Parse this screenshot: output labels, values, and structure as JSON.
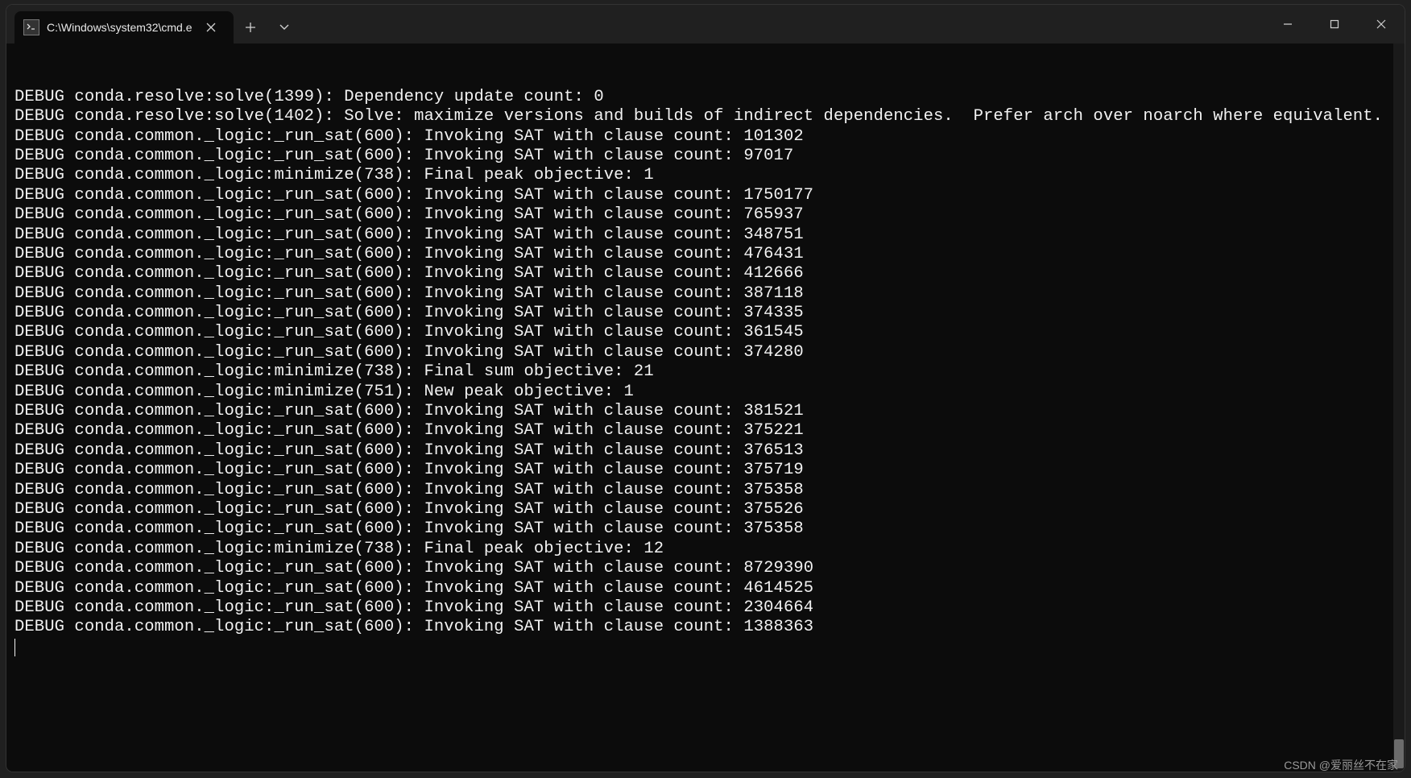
{
  "tab": {
    "title": "C:\\Windows\\system32\\cmd.e"
  },
  "lines": [
    "DEBUG conda.resolve:solve(1399): Dependency update count: 0",
    "DEBUG conda.resolve:solve(1402): Solve: maximize versions and builds of indirect dependencies.  Prefer arch over noarch where equivalent.",
    "DEBUG conda.common._logic:_run_sat(600): Invoking SAT with clause count: 101302",
    "DEBUG conda.common._logic:_run_sat(600): Invoking SAT with clause count: 97017",
    "DEBUG conda.common._logic:minimize(738): Final peak objective: 1",
    "DEBUG conda.common._logic:_run_sat(600): Invoking SAT with clause count: 1750177",
    "DEBUG conda.common._logic:_run_sat(600): Invoking SAT with clause count: 765937",
    "DEBUG conda.common._logic:_run_sat(600): Invoking SAT with clause count: 348751",
    "DEBUG conda.common._logic:_run_sat(600): Invoking SAT with clause count: 476431",
    "DEBUG conda.common._logic:_run_sat(600): Invoking SAT with clause count: 412666",
    "DEBUG conda.common._logic:_run_sat(600): Invoking SAT with clause count: 387118",
    "DEBUG conda.common._logic:_run_sat(600): Invoking SAT with clause count: 374335",
    "DEBUG conda.common._logic:_run_sat(600): Invoking SAT with clause count: 361545",
    "DEBUG conda.common._logic:_run_sat(600): Invoking SAT with clause count: 374280",
    "DEBUG conda.common._logic:minimize(738): Final sum objective: 21",
    "DEBUG conda.common._logic:minimize(751): New peak objective: 1",
    "DEBUG conda.common._logic:_run_sat(600): Invoking SAT with clause count: 381521",
    "DEBUG conda.common._logic:_run_sat(600): Invoking SAT with clause count: 375221",
    "DEBUG conda.common._logic:_run_sat(600): Invoking SAT with clause count: 376513",
    "DEBUG conda.common._logic:_run_sat(600): Invoking SAT with clause count: 375719",
    "DEBUG conda.common._logic:_run_sat(600): Invoking SAT with clause count: 375358",
    "DEBUG conda.common._logic:_run_sat(600): Invoking SAT with clause count: 375526",
    "DEBUG conda.common._logic:_run_sat(600): Invoking SAT with clause count: 375358",
    "DEBUG conda.common._logic:minimize(738): Final peak objective: 12",
    "DEBUG conda.common._logic:_run_sat(600): Invoking SAT with clause count: 8729390",
    "DEBUG conda.common._logic:_run_sat(600): Invoking SAT with clause count: 4614525",
    "DEBUG conda.common._logic:_run_sat(600): Invoking SAT with clause count: 2304664",
    "DEBUG conda.common._logic:_run_sat(600): Invoking SAT with clause count: 1388363"
  ],
  "watermark": "CSDN @爱丽丝不在家"
}
